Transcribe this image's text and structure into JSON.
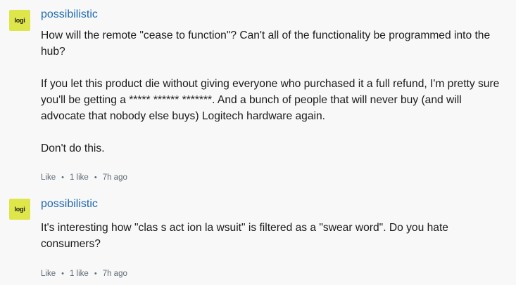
{
  "comments": [
    {
      "avatar_text": "logi",
      "author": "possibilistic",
      "paragraphs": [
        "How will the remote \"cease to function\"? Can't all of the functionality be programmed into the hub?",
        "If you let this product die without giving everyone who purchased it a full refund, I'm pretty sure you'll be getting a ***** ****** *******. And a bunch of people that will never buy (and will advocate that nobody else buys) Logitech hardware again.",
        "Don't do this."
      ],
      "like_label": "Like",
      "like_count": "1 like",
      "time": "7h ago"
    },
    {
      "avatar_text": "logi",
      "author": "possibilistic",
      "paragraphs": [
        "It's interesting how \"clas s act ion la wsuit\" is filtered as a \"swear word\". Do you hate consumers?"
      ],
      "like_label": "Like",
      "like_count": "1 like",
      "time": "7h ago"
    }
  ],
  "colors": {
    "avatar_bg": "#dfe64a",
    "author_link": "#1f69b4",
    "meta_text": "#5f6b76"
  },
  "icons": [
    "logi-avatar-icon"
  ]
}
